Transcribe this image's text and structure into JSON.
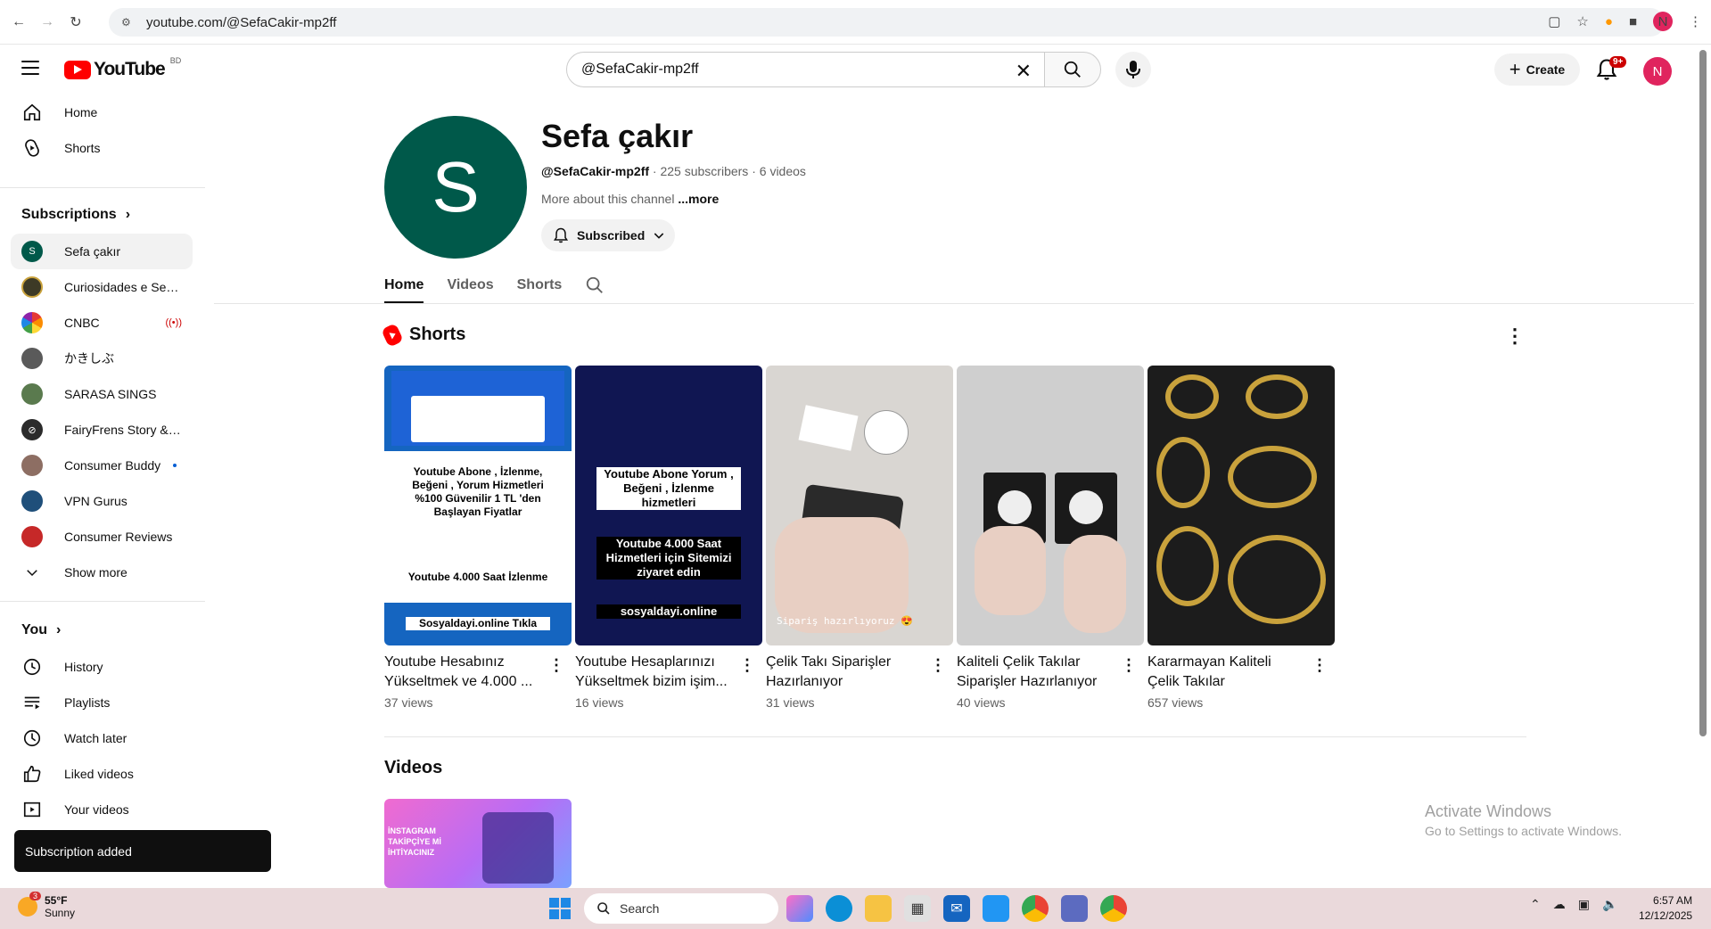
{
  "browser": {
    "url": "youtube.com/@SefaCakir-mp2ff",
    "profile_initial": "N"
  },
  "header": {
    "logo_text": "YouTube",
    "country_code": "BD",
    "search_value": "@SefaCakir-mp2ff",
    "create_label": "Create",
    "notif_badge": "9+",
    "avatar_initial": "N"
  },
  "sidebar": {
    "main": [
      {
        "label": "Home",
        "icon": "home-icon"
      },
      {
        "label": "Shorts",
        "icon": "shorts-icon"
      }
    ],
    "subscriptions_title": "Subscriptions",
    "subscriptions": [
      {
        "label": "Sefa çakır",
        "color": "#00594a",
        "initial": "S"
      },
      {
        "label": "Curiosidades e Seg...",
        "color": "#3d3a26",
        "initial": ""
      },
      {
        "label": "CNBC",
        "color": "#ffffff",
        "initial": ""
      },
      {
        "label": "かきしぶ",
        "color": "#5a5a5a",
        "initial": ""
      },
      {
        "label": "SARASA SINGS",
        "color": "#5a7a4e",
        "initial": ""
      },
      {
        "label": "FairyFrens Story & ...",
        "color": "#2b2b2b",
        "initial": ""
      },
      {
        "label": "Consumer Buddy",
        "color": "#8d6e63",
        "initial": ""
      },
      {
        "label": "VPN Gurus",
        "color": "#1f4f7a",
        "initial": ""
      },
      {
        "label": "Consumer Reviews",
        "color": "#c62828",
        "initial": ""
      }
    ],
    "show_more": "Show more",
    "you_title": "You",
    "you_items": [
      {
        "label": "History",
        "icon": "history-icon"
      },
      {
        "label": "Playlists",
        "icon": "playlists-icon"
      },
      {
        "label": "Watch later",
        "icon": "watch-later-icon"
      },
      {
        "label": "Liked videos",
        "icon": "liked-videos-icon"
      },
      {
        "label": "Your videos",
        "icon": "your-videos-icon"
      }
    ]
  },
  "channel": {
    "avatar_initial": "S",
    "name": "Sefa çakır",
    "handle": "@SefaCakir-mp2ff",
    "subscribers": "225 subscribers",
    "videos_count": "6 videos",
    "about": "More about this channel",
    "more_link": "...more",
    "subscribed_label": "Subscribed",
    "tabs": [
      "Home",
      "Videos",
      "Shorts"
    ]
  },
  "shorts_section": {
    "title": "Shorts",
    "items": [
      {
        "title": "Youtube Hesabınız Yükseltmek ve 4.000 ...",
        "views": "37 views",
        "caption": "Youtube Abone , İzlenme, Beğeni , Yorum Hizmetleri %100 Güvenilir 1 TL 'den Başlayan Fiyatlar",
        "caption2": "Youtube 4.000 Saat İzlenme",
        "caption3": "Sosyaldayi.online Tıkla"
      },
      {
        "title": "Youtube Hesaplarınızı Yükseltmek bizim işim...",
        "views": "16 views",
        "caption": "Youtube Abone Yorum , Beğeni , İzlenme hizmetleri",
        "caption2": "Youtube 4.000 Saat Hizmetleri için Sitemizi ziyaret edin",
        "caption3": "sosyaldayi.online"
      },
      {
        "title": "Çelik Takı  Siparişler Hazırlanıyor",
        "views": "31 views",
        "caption": "Sipariş hazırlıyoruz 😍"
      },
      {
        "title": "Kaliteli Çelik Takılar Siparişler Hazırlanıyor",
        "views": "40 views"
      },
      {
        "title": "Kararmayan Kaliteli Çelik Takılar",
        "views": "657 views"
      }
    ]
  },
  "videos_section": {
    "title": "Videos",
    "thumb_text": "İNSTAGRAM TAKİPÇİYE Mİ İHTİYACINIZ"
  },
  "watermark": {
    "line1": "Activate Windows",
    "line2": "Go to Settings to activate Windows."
  },
  "toast": "Subscription added",
  "taskbar": {
    "temp": "55°F",
    "condition": "Sunny",
    "weather_badge": "3",
    "search_placeholder": "Search",
    "time": "6:57 AM",
    "date": "12/12/2025"
  }
}
